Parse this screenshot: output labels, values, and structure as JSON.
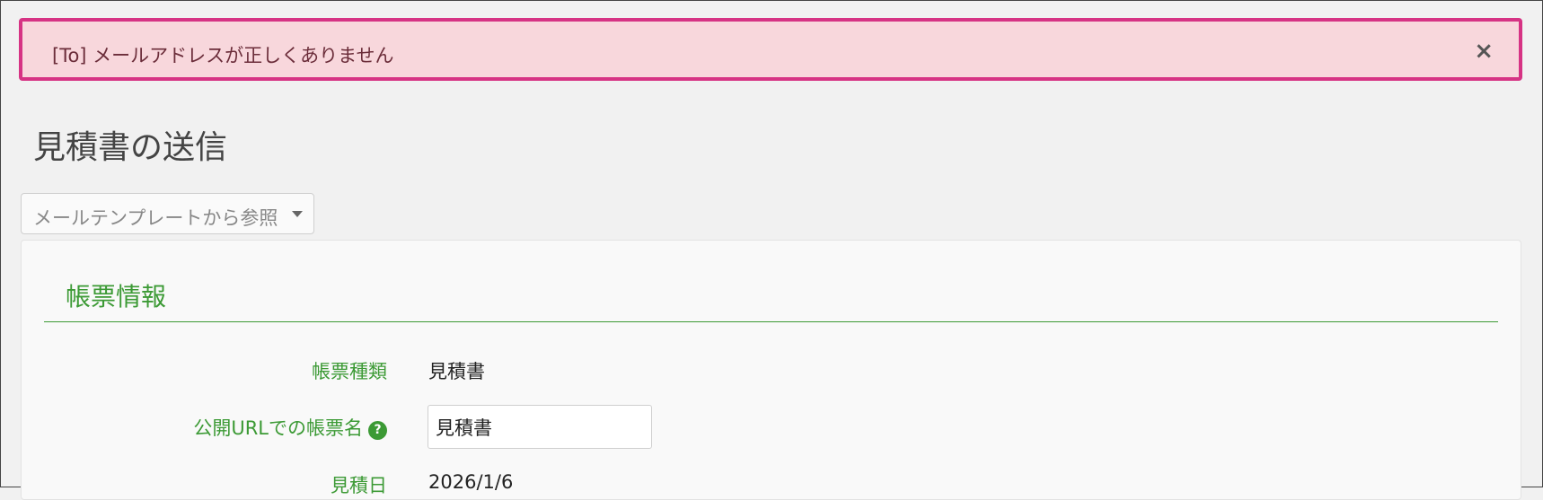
{
  "alert": {
    "message": "[To] メールアドレスが正しくありません",
    "close_glyph": "×",
    "border_color": "#d63384",
    "background_color": "#f8d7dc"
  },
  "page": {
    "title": "見積書の送信"
  },
  "template_dropdown": {
    "label": "メールテンプレートから参照"
  },
  "section": {
    "title": "帳票情報",
    "accent_color": "#3c9a35",
    "fields": {
      "doc_type": {
        "label": "帳票種類",
        "value": "見積書"
      },
      "public_name": {
        "label": "公開URLでの帳票名",
        "help_glyph": "?",
        "value": "見積書"
      },
      "estimate_date": {
        "label": "見積日",
        "value": "2026/1/6"
      }
    }
  },
  "icons": {
    "close": "close-icon",
    "caret": "caret-down-icon",
    "help": "help-icon"
  }
}
